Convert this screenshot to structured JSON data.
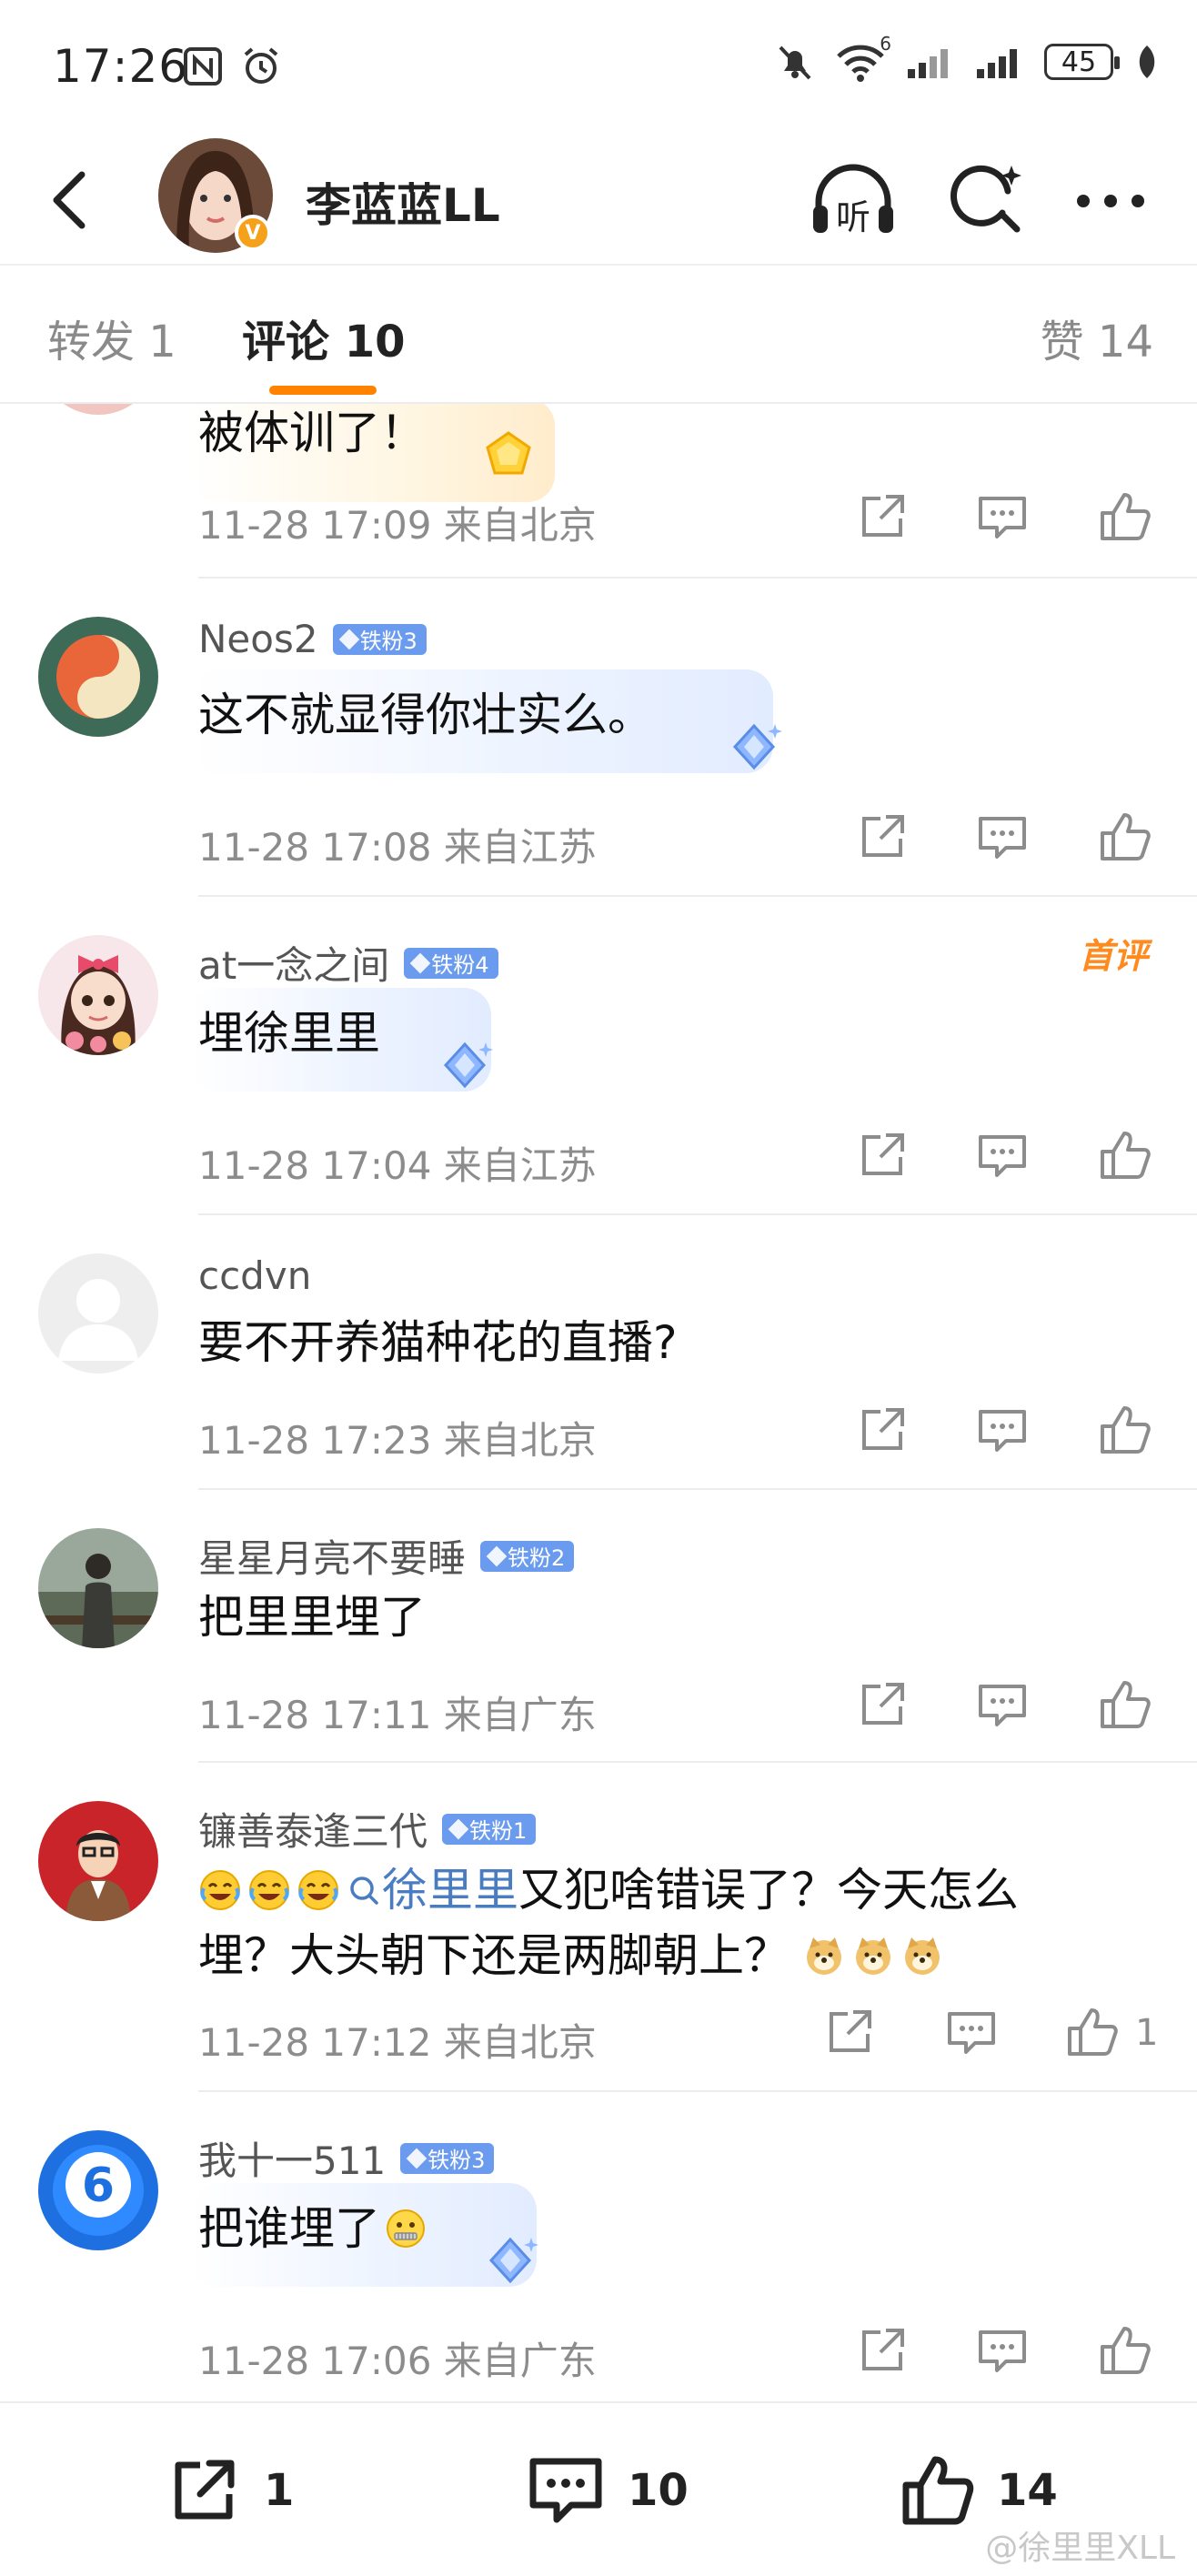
{
  "status_bar": {
    "time": "17:26",
    "battery": "45",
    "signal_tag": "6"
  },
  "header": {
    "title": "李蓝蓝LL",
    "verified_mark": "V",
    "icons": [
      "back-icon",
      "listen-icon",
      "search-icon",
      "more-icon"
    ],
    "listen_label": "听"
  },
  "tabs": [
    {
      "label": "转发 1"
    },
    {
      "label": "评论 10",
      "active": true
    },
    {
      "label": "赞 14"
    }
  ],
  "partial_comment": {
    "text_fragment": "被体训了！",
    "meta": "11-28 17:09  来自北京"
  },
  "comments": [
    {
      "username": "Neos2",
      "badge": "铁粉3",
      "content": "这不就显得你壮实么。",
      "meta": "11-28 17:08  来自江苏",
      "likes": ""
    },
    {
      "username": "at一念之间",
      "badge": "铁粉4",
      "first_badge": "首评",
      "content": "埋徐里里",
      "meta": "11-28 17:04  来自江苏",
      "likes": ""
    },
    {
      "username": "ccdvn",
      "badge": "",
      "content": "要不开养猫种花的直播?",
      "meta": "11-28 17:23  来自北京",
      "likes": ""
    },
    {
      "username": "星星月亮不要睡",
      "badge": "铁粉2",
      "content": "把里里埋了",
      "meta": "11-28 17:11  来自广东",
      "likes": ""
    },
    {
      "username": "镰善泰逢三代",
      "badge": "铁粉1",
      "mention": "徐里里",
      "content_line1_rest": " 又犯啥错误了？今天怎么",
      "content_line2": "埋？大头朝下还是两脚朝上？",
      "meta": "11-28 17:12  来自北京",
      "likes": "1"
    },
    {
      "username": "我十一511",
      "badge": "铁粉3",
      "content": "把谁埋了",
      "meta": "11-28 17:06  来自广东",
      "likes": ""
    }
  ],
  "bottom_bar": {
    "repost_count": "1",
    "comment_count": "10",
    "like_count": "14"
  },
  "watermark": "@徐里里XLL",
  "colors": {
    "accent": "#ff8200",
    "badge": "#6a9bee",
    "mention": "#4a7cc2",
    "first_badge": "#ff8a1d"
  }
}
